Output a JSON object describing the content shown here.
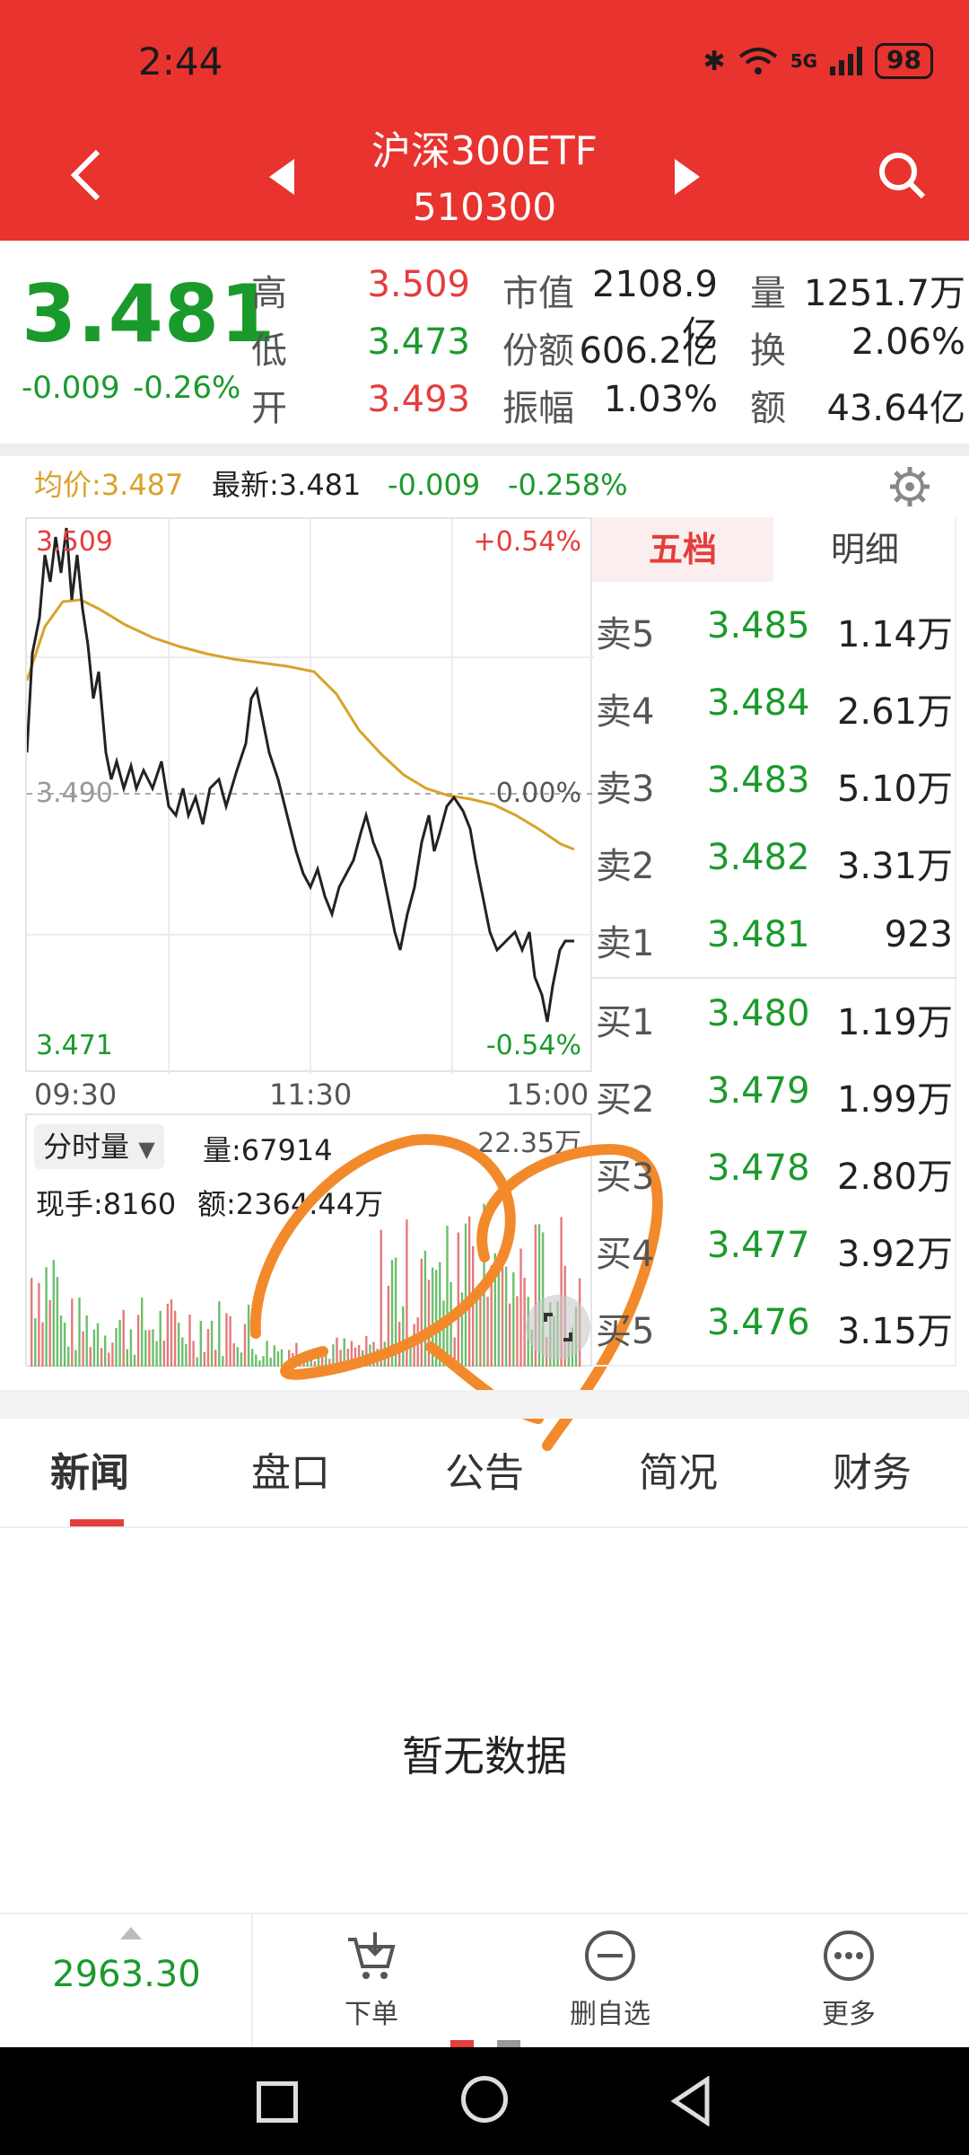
{
  "status": {
    "time": "2:44",
    "battery": "98",
    "network": "5G"
  },
  "header": {
    "title": "沪深300ETF",
    "code": "510300"
  },
  "quote": {
    "price": "3.481",
    "change": "-0.009",
    "change_pct": "-0.26%",
    "high_label": "高",
    "high": "3.509",
    "low_label": "低",
    "low": "3.473",
    "open_label": "开",
    "open": "3.493",
    "mcap_label": "市值",
    "mcap": "2108.9亿",
    "shares_label": "份额",
    "shares": "606.2亿",
    "amp_label": "振幅",
    "amp": "1.03%",
    "vol_label": "量",
    "vol": "1251.7万",
    "turn_label": "换",
    "turn": "2.06%",
    "amt_label": "额",
    "amt": "43.64亿"
  },
  "avgbar": {
    "avg": "均价:3.487",
    "latest": "最新:3.481",
    "chg": "-0.009",
    "chg_pct": "-0.258%"
  },
  "chart": {
    "top_price": "3.509",
    "top_pct": "+0.54%",
    "mid_price": "3.490",
    "mid_pct": "0.00%",
    "bottom_price": "3.471",
    "bottom_pct": "-0.54%",
    "t_start": "09:30",
    "t_mid": "11:30",
    "t_end": "15:00"
  },
  "volume": {
    "selector": "分时量",
    "vol": "量:67914",
    "max": "22.35万",
    "current_hand": "现手:8160",
    "amount": "额:2364.44万"
  },
  "book": {
    "tab_five": "五档",
    "tab_detail": "明细",
    "asks": [
      {
        "label": "卖5",
        "price": "3.485",
        "vol": "1.14万"
      },
      {
        "label": "卖4",
        "price": "3.484",
        "vol": "2.61万"
      },
      {
        "label": "卖3",
        "price": "3.483",
        "vol": "5.10万"
      },
      {
        "label": "卖2",
        "price": "3.482",
        "vol": "3.31万"
      },
      {
        "label": "卖1",
        "price": "3.481",
        "vol": "923"
      }
    ],
    "bids": [
      {
        "label": "买1",
        "price": "3.480",
        "vol": "1.19万"
      },
      {
        "label": "买2",
        "price": "3.479",
        "vol": "1.99万"
      },
      {
        "label": "买3",
        "price": "3.478",
        "vol": "2.80万"
      },
      {
        "label": "买4",
        "price": "3.477",
        "vol": "3.92万"
      },
      {
        "label": "买5",
        "price": "3.476",
        "vol": "3.15万"
      }
    ]
  },
  "tabs": [
    "新闻",
    "盘口",
    "公告",
    "简况",
    "财务"
  ],
  "empty": "暂无数据",
  "bottom": {
    "index": "2963.30",
    "order": "下单",
    "remove": "删自选",
    "more": "更多"
  },
  "colors": {
    "header": "#e8332f",
    "up": "#e53d3d",
    "down": "#1b9a2c",
    "avg_line": "#d9a22a",
    "annotation": "#f28a2c"
  }
}
